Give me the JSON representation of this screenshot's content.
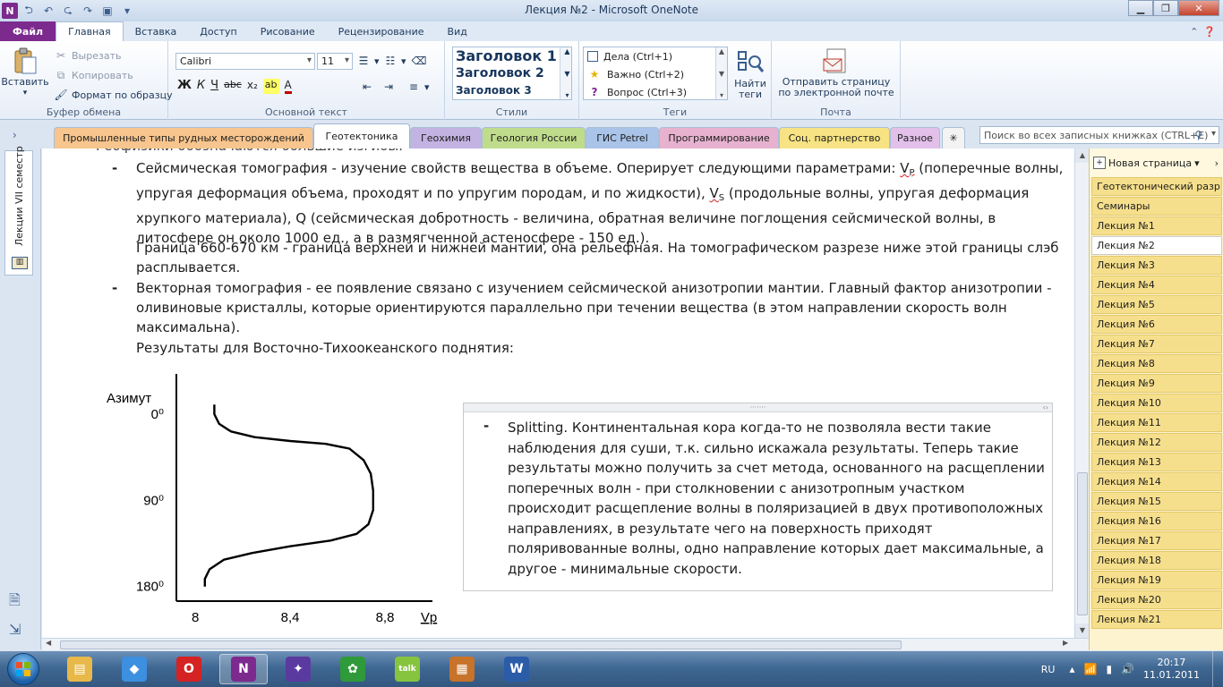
{
  "window": {
    "title": "Лекция №2  -  Microsoft OneNote",
    "app_logo": "N"
  },
  "ribbon_tabs": [
    {
      "label": "Файл"
    },
    {
      "label": "Главная"
    },
    {
      "label": "Вставка"
    },
    {
      "label": "Доступ"
    },
    {
      "label": "Рисование"
    },
    {
      "label": "Рецензирование"
    },
    {
      "label": "Вид"
    }
  ],
  "clipboard": {
    "paste_label": "Вставить",
    "cut_label": "Вырезать",
    "copy_label": "Копировать",
    "format_painter_label": "Формат по образцу",
    "group_label": "Буфер обмена"
  },
  "text_group": {
    "font_name": "Calibri",
    "font_size": "11",
    "bold": "Ж",
    "italic": "К",
    "underline": "Ч",
    "strike": "abc",
    "subscript": "x₂",
    "group_label": "Основной текст"
  },
  "styles": {
    "items": [
      "Заголовок 1",
      "Заголовок 2",
      "Заголовок 3"
    ],
    "group_label": "Стили"
  },
  "tags": {
    "items": [
      {
        "label": "Дела (Ctrl+1)"
      },
      {
        "label": "Важно (Ctrl+2)"
      },
      {
        "label": "Вопрос (Ctrl+3)"
      }
    ],
    "find_label": "Найти теги",
    "group_label": "Теги"
  },
  "mail": {
    "send_label": "Отправить страницу по электронной почте",
    "group_label": "Почта"
  },
  "sections": [
    {
      "label": "Промышленные типы рудных месторождений",
      "color": "#f7c58d"
    },
    {
      "label": "Геотектоника",
      "color": "#ffffff"
    },
    {
      "label": "Геохимия",
      "color": "#c3b3e3"
    },
    {
      "label": "Геология России",
      "color": "#bfdc8c"
    },
    {
      "label": "ГИС Petrel",
      "color": "#a9c4e8"
    },
    {
      "label": "Программирование",
      "color": "#e7b2cf"
    },
    {
      "label": "Соц. партнерство",
      "color": "#f7e383"
    },
    {
      "label": "Разное",
      "color": "#e2c0ea"
    }
  ],
  "search": {
    "placeholder": "Поиск во всех записных книжках (CTRL+E)"
  },
  "notebook": {
    "name": "Лекции VII семестр"
  },
  "content": {
    "cut_line": "Геофизики обозначаются большие изгибы.",
    "bullet": "-",
    "p1_a": "Сейсмическая томография - изучение свойств вещества в объеме. Оперирует следующими параметрами: ",
    "p1_vp": "V",
    "p1_vp_sub": "P",
    "p1_b": " (поперечные волны, упругая деформация объема, проходят и по упругим породам, и по жидкости), ",
    "p1_vs": "V",
    "p1_vs_sub": "S",
    "p1_c": " (продольные волны, упругая деформация хрупкого материала), Q (сейсмическая добротность - величина, обратная величине поглощения сейсмической волны, в литосфере он около 1000 ед., а в размягченной астеносфере - 150 ед.).",
    "p2": "Граница 660-670 км - граница верхней и нижней мантии, она рельефная. На томографическом разрезе ниже этой границы слэб расплывается.",
    "p3": "Векторная томография - ее появление связано с изучением сейсмической анизотропии мантии. Главный фактор анизотропии - оливиновые кристаллы, которые ориентируются параллельно при течении вещества (в этом направлении скорость волн максимальна).",
    "p4": "Результаты для Восточно-Тихоокеанского поднятия:"
  },
  "note": {
    "bullet": "-",
    "text": "Splitting. Континентальная кора когда-то не позволяла вести такие наблюдения для суши, т.к. сильно искажала результаты. Теперь такие результаты можно получить за счет метода, основанного на расщеплении поперечных волн - при столкновении с анизотропным участком происходит расщепление волны в поляризацией в двух противоположных направлениях, в результате чего на поверхность приходят поляривованные волны, одно направление которых дает максимальные, а другое - минимальные скорости."
  },
  "chart_data": {
    "type": "line",
    "ylabel": "Азимут",
    "xlabel": "Vp",
    "y_ticks": [
      {
        "value": 0,
        "label": "0⁰"
      },
      {
        "value": 90,
        "label": "90⁰"
      },
      {
        "value": 180,
        "label": "180⁰"
      }
    ],
    "x_ticks": [
      {
        "value": 8.0,
        "label": "8"
      },
      {
        "value": 8.4,
        "label": "8,4"
      },
      {
        "value": 8.8,
        "label": "8,8"
      }
    ],
    "xlim": [
      7.92,
      9.0
    ],
    "ylim": [
      -14,
      184
    ],
    "y_inverted": true,
    "series": [
      {
        "points": [
          [
            8.08,
            -10
          ],
          [
            8.08,
            0
          ],
          [
            8.1,
            10
          ],
          [
            8.15,
            18
          ],
          [
            8.25,
            24
          ],
          [
            8.4,
            28
          ],
          [
            8.55,
            31
          ],
          [
            8.65,
            36
          ],
          [
            8.71,
            48
          ],
          [
            8.74,
            62
          ],
          [
            8.75,
            80
          ],
          [
            8.75,
            100
          ],
          [
            8.73,
            115
          ],
          [
            8.68,
            125
          ],
          [
            8.57,
            132
          ],
          [
            8.4,
            138
          ],
          [
            8.24,
            145
          ],
          [
            8.12,
            152
          ],
          [
            8.06,
            162
          ],
          [
            8.04,
            172
          ],
          [
            8.04,
            180
          ]
        ]
      }
    ]
  },
  "pages": {
    "new_page_label": "Новая страница",
    "items": [
      "Геотектонический разр",
      "Семинары",
      "Лекция №1",
      "Лекция №2",
      "Лекция №3",
      "Лекция №4",
      "Лекция №5",
      "Лекция №6",
      "Лекция №7",
      "Лекция №8",
      "Лекция №9",
      "Лекция №10",
      "Лекция №11",
      "Лекция №12",
      "Лекция №13",
      "Лекция №14",
      "Лекция №15",
      "Лекция №16",
      "Лекция №17",
      "Лекция №18",
      "Лекция №19",
      "Лекция №20",
      "Лекция №21"
    ],
    "selected_index": 3
  },
  "taskbar": {
    "language": "RU",
    "time": "20:17",
    "date": "11.01.2011",
    "apps": [
      {
        "name": "explorer",
        "glyph": "▤",
        "color": "#e8b94a"
      },
      {
        "name": "dropbox",
        "glyph": "◆",
        "color": "#3d8fe0"
      },
      {
        "name": "opera",
        "glyph": "O",
        "color": "#d52222"
      },
      {
        "name": "onenote",
        "glyph": "N",
        "color": "#7d2a8f"
      },
      {
        "name": "app5",
        "glyph": "✦",
        "color": "#5b3aa0"
      },
      {
        "name": "app6",
        "glyph": "✿",
        "color": "#2f9a3a"
      },
      {
        "name": "gtalk",
        "glyph": "talk",
        "color": "#86c440"
      },
      {
        "name": "app8",
        "glyph": "▦",
        "color": "#c8732a"
      },
      {
        "name": "word",
        "glyph": "W",
        "color": "#2b5ca8"
      }
    ]
  }
}
